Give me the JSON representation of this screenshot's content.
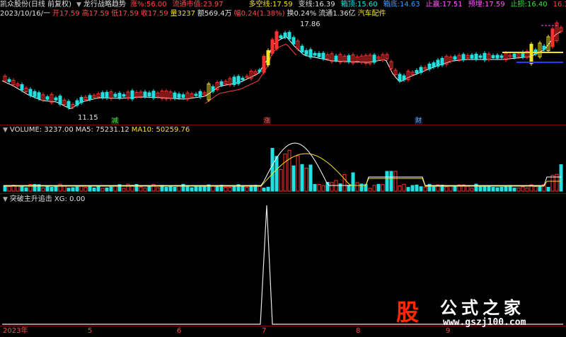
{
  "header": {
    "stock_name": "凯众股份(日线 前复权)",
    "indicator": "龙行战略趋势",
    "fields": [
      {
        "label": "涨%:",
        "value": "56.00",
        "color": "#ff4a4a"
      },
      {
        "label": "流通市值:",
        "value": "23.97",
        "color": "#ff4a4a"
      },
      {
        "label": "多空线:",
        "value": "17.59",
        "color": "#f2e22a"
      },
      {
        "label": "变线:",
        "value": "16.39",
        "color": "#e0e0e0"
      },
      {
        "label": "箱顶:",
        "value": "15.60",
        "color": "#22e0e0"
      },
      {
        "label": "箱底:",
        "value": "14.63",
        "color": "#3aa0ff"
      },
      {
        "label": "止赢:",
        "value": "17.51",
        "color": "#ff5aff"
      },
      {
        "label": "预埋:",
        "value": "17.59",
        "color": "#ff5aff"
      },
      {
        "label": "止损:",
        "value": "16.40",
        "color": "#44dd44"
      },
      {
        "label": "",
        "value": "16.39",
        "color": "#ff4a4a"
      }
    ]
  },
  "ohlc_line": {
    "date": "2023/10/16/一",
    "open": "开17.59",
    "high": "高17.59",
    "low": "低17.59",
    "close": "收17.59",
    "volume": "量3237",
    "amount": "额569.4万",
    "change": "幅0.24(1.38%)",
    "turnover": "换0.24%",
    "float_value": "流通1.36亿",
    "sector": "汽车配件"
  },
  "price_annotations": {
    "high_label": "17.86",
    "low_label": "11.15",
    "tag_down": "减",
    "tag_up": "涨",
    "tag_fin": "财"
  },
  "volume_panel": {
    "title": "VOLUME: 3237.00",
    "ma5": "MA5: 75231.12",
    "ma10": "MA10: 50259.76"
  },
  "signal_panel": {
    "title": "突破主升追击",
    "xg": "XG: 0.00"
  },
  "x_axis": {
    "labels": [
      "2023年",
      "5",
      "6",
      "7",
      "8",
      "9"
    ]
  },
  "watermark": {
    "char": "股",
    "site_name": "公式之家",
    "url": "www.gszj100.com"
  },
  "colors": {
    "up": "#ff3030",
    "down": "#22e0e0",
    "ma": "#ffffff",
    "ma_red": "#ff4040",
    "yellow": "#f2e22a",
    "blue_box": "#2a3aff",
    "divider": "#7a0000"
  }
}
